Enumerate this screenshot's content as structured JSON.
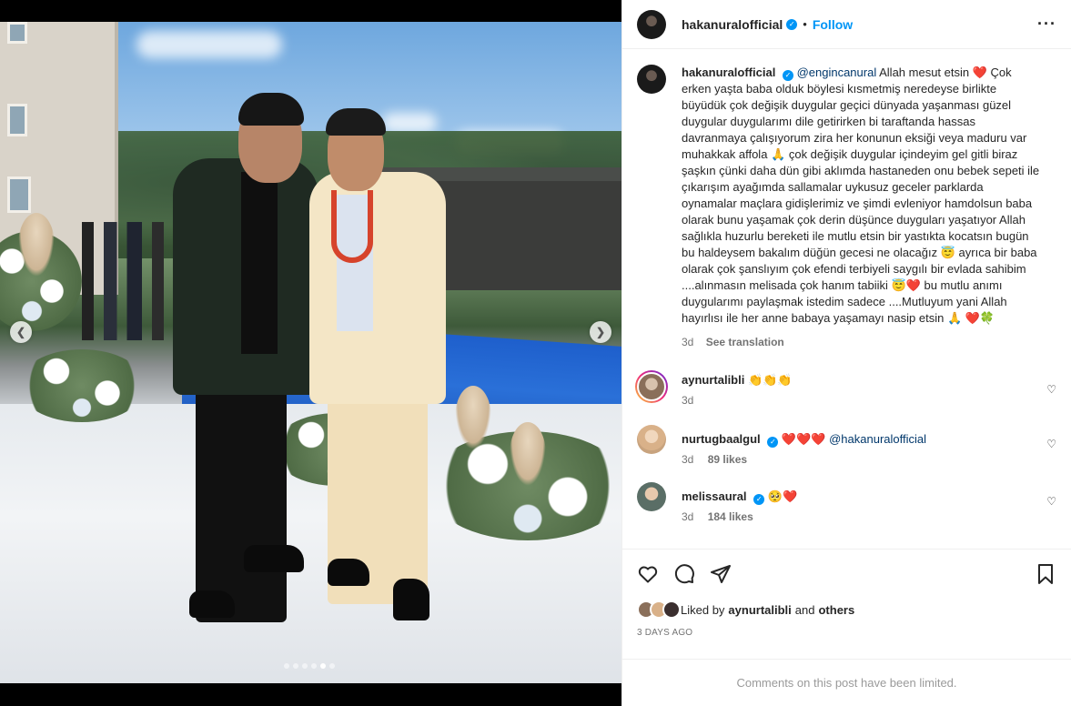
{
  "post": {
    "username": "hakanuralofficial",
    "follow_label": "Follow",
    "bullet": "•",
    "more_label": "···"
  },
  "caption": {
    "username": "hakanuralofficial",
    "mention": "@engincanural",
    "text": "Allah mesut etsin ❤️ Çok erken yaşta baba olduk böylesi kısmetmiş neredeyse birlikte büyüdük çok değişik duygular geçici dünyada yaşanması güzel duygular duygularımı dile getirirken bi taraftanda hassas davranmaya çalışıyorum zira her konunun eksiği veya maduru var muhakkak affola 🙏 çok değişik duygular içindeyim gel gitli biraz şaşkın çünki daha dün gibi aklımda hastaneden onu bebek sepeti ile çıkarışım ayağımda sallamalar uykusuz geceler parklarda oynamalar maçlara gidişlerimiz ve şimdi evleniyor hamdolsun baba olarak bunu yaşamak çok derin düşünce duyguları yaşatıyor Allah sağlıkla huzurlu bereketi ile mutlu etsin bir yastıkta kocatsın bugün bu haldeysem bakalım düğün gecesi ne olacağız 😇 ayrıca bir baba olarak çok şanslıyım çok efendi terbiyeli saygılı bir evlada sahibim ....alınmasın melisada çok hanım tabiiki 😇❤️ bu mutlu anımı duygularımı paylaşmak istedim sadece ....Mutluyum yani Allah hayırlısı ile her anne babaya yaşamayı nasip etsin 🙏 ❤️🍀",
    "time": "3d",
    "see_translation": "See translation"
  },
  "comments": [
    {
      "username": "aynurtalibli",
      "text": "👏👏👏",
      "mention": "",
      "time": "3d",
      "likes": ""
    },
    {
      "username": "nurtugbaalgul",
      "text": "❤️❤️❤️",
      "mention": "@hakanuralofficial",
      "time": "3d",
      "likes": "89 likes"
    },
    {
      "username": "melissaural",
      "text": "🥺❤️",
      "mention": "",
      "time": "3d",
      "likes": "184 likes"
    }
  ],
  "likes": {
    "prefix": "Liked by",
    "who": "aynurtalibli",
    "and": "and",
    "others": "others",
    "ago": "3 DAYS AGO"
  },
  "footer": {
    "limited": "Comments on this post have been limited."
  },
  "carousel": {
    "total": 6,
    "active_index": 4,
    "prev_icon": "chevron-left-icon",
    "next_icon": "chevron-right-icon"
  },
  "colors": {
    "accent": "#0095f6",
    "mention": "#00376b",
    "muted": "#737373"
  }
}
